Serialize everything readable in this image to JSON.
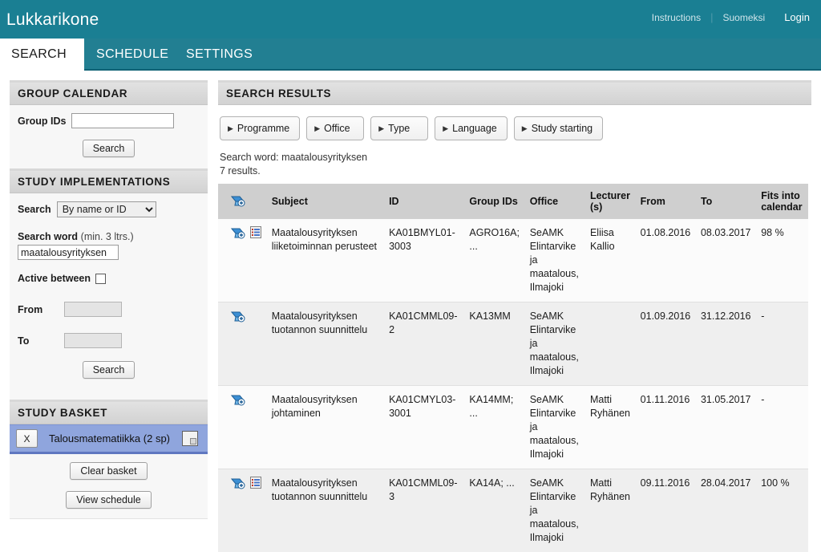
{
  "header": {
    "brand": "Lukkarikone",
    "links": [
      {
        "label": "Instructions",
        "name": "instructions"
      },
      {
        "label": "Suomeksi",
        "name": "suomeksi"
      },
      {
        "label": "Login",
        "name": "login"
      }
    ],
    "separator": "|",
    "accent_color": "#1a7f93"
  },
  "tabs": [
    {
      "label": "SEARCH",
      "active": true
    },
    {
      "label": "SCHEDULE",
      "active": false
    },
    {
      "label": "SETTINGS",
      "active": false
    }
  ],
  "sidebar": {
    "group_calendar": {
      "title": "GROUP CALENDAR",
      "group_ids_label": "Group IDs",
      "group_ids_value": "",
      "search_button": "Search"
    },
    "study_implementations": {
      "title": "STUDY IMPLEMENTATIONS",
      "search_label": "Search",
      "search_mode_selected": "By name or ID",
      "search_mode_options": [
        "By name or ID"
      ],
      "search_word_label": "Search word",
      "search_word_hint": "(min. 3 ltrs.)",
      "search_word_value": "maatalousyrityksen",
      "active_between_label": "Active between",
      "active_between_checked": false,
      "from_label": "From",
      "from_value": "",
      "to_label": "To",
      "to_value": "",
      "search_button": "Search"
    },
    "study_basket": {
      "title": "STUDY BASKET",
      "items": [
        {
          "remove_label": "X",
          "name": "Talousmatematiikka (2 sp)"
        }
      ],
      "clear_button": "Clear basket",
      "view_button": "View schedule",
      "highlight_color": "#8fa5dd"
    }
  },
  "results": {
    "title": "SEARCH RESULTS",
    "filters": [
      {
        "label": "Programme"
      },
      {
        "label": "Office"
      },
      {
        "label": "Type"
      },
      {
        "label": "Language"
      },
      {
        "label": "Study starting"
      }
    ],
    "search_word_line": "Search word: maatalousyrityksen",
    "results_count_line": "7 results.",
    "columns": [
      "",
      "",
      "Subject",
      "ID",
      "Group IDs",
      "Office",
      "Lecturer (s)",
      "From",
      "To",
      "Fits into calendar"
    ],
    "rows": [
      {
        "has_add_icon": true,
        "has_list_icon": true,
        "subject": "Maatalousyrityksen liiketoiminnan perusteet",
        "id": "KA01BMYL01-3003",
        "group_ids": "AGRO16A; ...",
        "office": "SeAMK Elintarvike ja maatalous, Ilmajoki",
        "lecturer": "Eliisa Kallio",
        "from": "01.08.2016",
        "to": "08.03.2017",
        "fits": "98 %"
      },
      {
        "has_add_icon": true,
        "has_list_icon": false,
        "subject": "Maatalousyrityksen tuotannon suunnittelu",
        "id": "KA01CMML09-2",
        "group_ids": "KA13MM",
        "office": "SeAMK Elintarvike ja maatalous, Ilmajoki",
        "lecturer": "",
        "from": "01.09.2016",
        "to": "31.12.2016",
        "fits": "-"
      },
      {
        "has_add_icon": true,
        "has_list_icon": false,
        "subject": "Maatalousyrityksen johtaminen",
        "id": "KA01CMYL03-3001",
        "group_ids": "KA14MM; ...",
        "office": "SeAMK Elintarvike ja maatalous, Ilmajoki",
        "lecturer": "Matti Ryhänen",
        "from": "01.11.2016",
        "to": "31.05.2017",
        "fits": "-"
      },
      {
        "has_add_icon": true,
        "has_list_icon": true,
        "subject": "Maatalousyrityksen tuotannon suunnittelu",
        "id": "KA01CMML09-3",
        "group_ids": "KA14A; ...",
        "office": "SeAMK Elintarvike ja maatalous, Ilmajoki",
        "lecturer": "Matti Ryhänen",
        "from": "09.11.2016",
        "to": "28.04.2017",
        "fits": "100 %"
      }
    ]
  }
}
